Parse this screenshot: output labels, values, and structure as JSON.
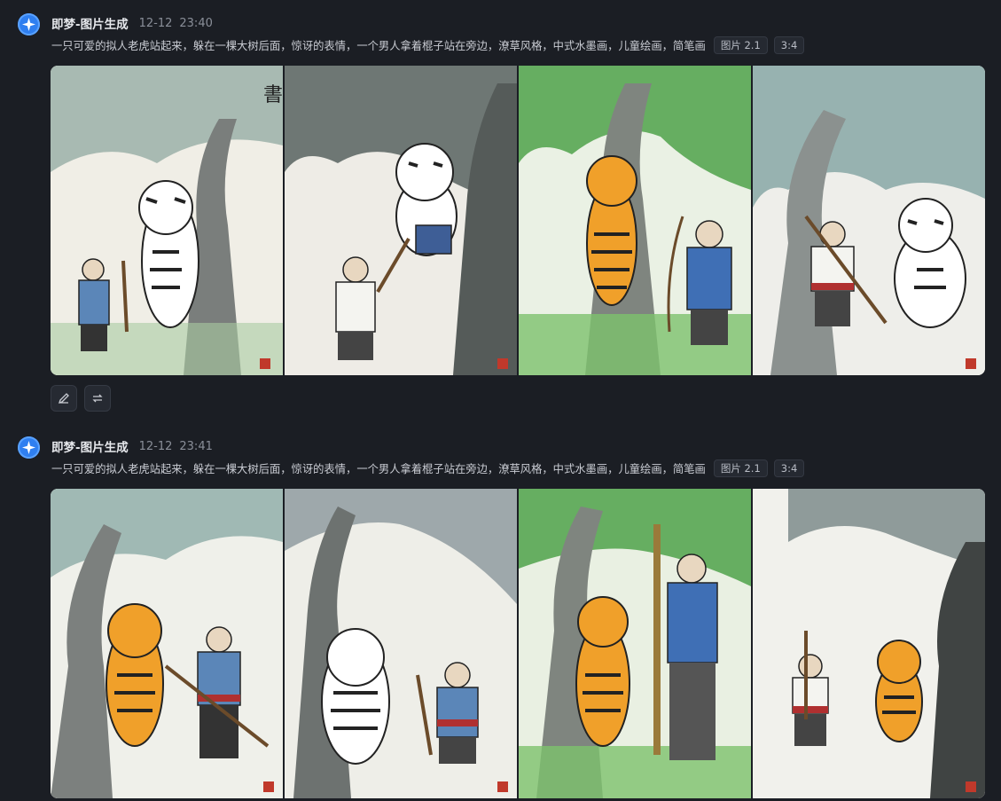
{
  "messages": [
    {
      "sender": "即梦-图片生成",
      "date": "12-12",
      "time": "23:40",
      "prompt": "一只可爱的拟人老虎站起来，躲在一棵大树后面，惊讶的表情，一个男人拿着棍子站在旁边，潦草风格，中式水墨画，儿童绘画，简笔画",
      "model_tag": "图片 2.1",
      "ratio_tag": "3:4",
      "images": [
        {
          "subject": "white-tiger",
          "scene": "willow"
        },
        {
          "subject": "white-tiger",
          "scene": "dark-tree"
        },
        {
          "subject": "orange-tiger",
          "scene": "green-tree"
        },
        {
          "subject": "white-tiger",
          "scene": "willow"
        }
      ],
      "actions": [
        {
          "icon": "edit-icon"
        },
        {
          "icon": "regenerate-icon"
        }
      ]
    },
    {
      "sender": "即梦-图片生成",
      "date": "12-12",
      "time": "23:41",
      "prompt": "一只可爱的拟人老虎站起来，躲在一棵大树后面，惊讶的表情，一个男人拿着棍子站在旁边，潦草风格，中式水墨画，儿童绘画，简笔画",
      "model_tag": "图片 2.1",
      "ratio_tag": "3:4",
      "images": [
        {
          "subject": "orange-tiger",
          "scene": "willow"
        },
        {
          "subject": "white-tiger",
          "scene": "willow"
        },
        {
          "subject": "orange-tiger",
          "scene": "green-tree"
        },
        {
          "subject": "orange-tiger",
          "scene": "dark-tree"
        }
      ]
    }
  ],
  "colors": {
    "background": "#1b1e24",
    "accent": "#2f7ff0",
    "tiger_orange": "#f0a02a",
    "man_blue": "#3f6fb5"
  }
}
